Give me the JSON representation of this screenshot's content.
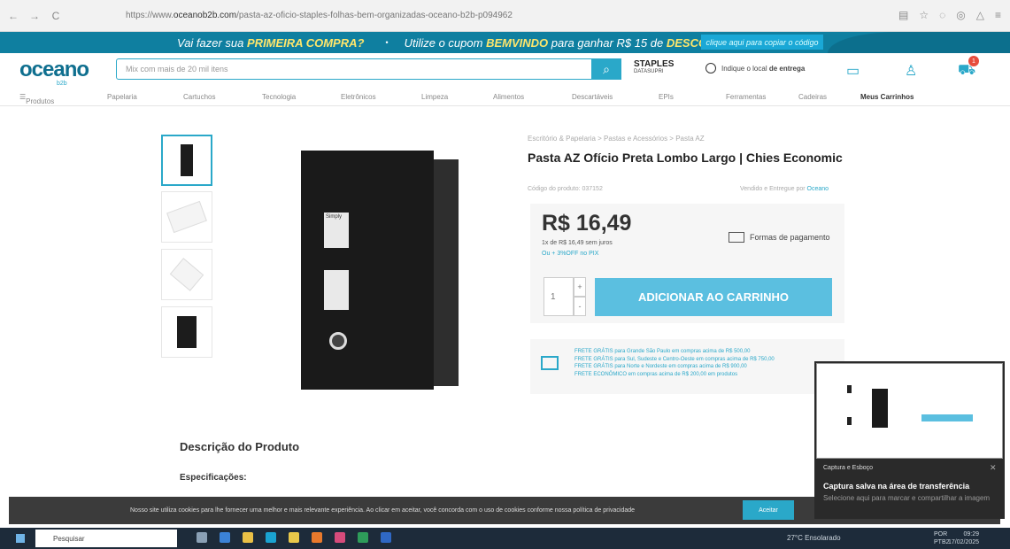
{
  "browser": {
    "url_prefix": "https://www.",
    "url_host": "oceanob2b.com",
    "url_path": "/pasta-az-oficio-staples-folhas-bem-organizadas-oceano-b2b-p094962"
  },
  "promo": {
    "part1": "Vai fazer sua ",
    "part1_bold": "PRIMEIRA COMPRA?",
    "part2": "Utilize o cupom ",
    "part2_bold": "BEMVINDO",
    "part3": " para ganhar R$ 15 de ",
    "part3_bold": "DESCONTO",
    "cta": "clique aqui para copiar o código"
  },
  "header": {
    "logo": "oceano",
    "logo_sub": "b2b",
    "search_placeholder": "Mix com mais de 20 mil itens",
    "staples": "STAPLES",
    "staples_sub": "DATASUPRI",
    "location_prefix": "Indique o local ",
    "location_bold": "de entrega",
    "cart_count": "1"
  },
  "categories": [
    "Produtos",
    "Papelaria",
    "Cartuchos",
    "Tecnologia",
    "Eletrônicos",
    "Limpeza",
    "Alimentos",
    "Descartáveis",
    "EPIs",
    "Ferramentas",
    "Cadeiras",
    "Meus Carrinhos"
  ],
  "product": {
    "breadcrumb": "Escritório & Papelaria > Pastas e Acessórios > Pasta AZ",
    "title": "Pasta AZ Ofício Preta Lombo Largo | Chies Economic",
    "code": "Código do produto: 037152",
    "sold_prefix": "Vendido e Entregue por ",
    "sold_by": "Oceano",
    "price": "R$ 16,49",
    "installments": "1x de R$ 16,49 sem juros",
    "pix": "Ou + 3%OFF no PIX",
    "payment_label": "Formas de pagamento",
    "qty": "1",
    "add_to_cart": "ADICIONAR AO CARRINHO",
    "label_brand": "Simply",
    "shipping": [
      "FRETE GRÁTIS para Grande São Paulo em compras acima de R$ 500,00",
      "FRETE GRÁTIS para Sul, Sudeste e Centro-Oeste em compras acima de R$ 750,00",
      "FRETE GRÁTIS para Norte e Nordeste em compras acima de R$ 900,00",
      "FRETE ECONÔMICO em compras acima de R$ 200,00 em produtos"
    ],
    "description_title": "Descrição do Produto",
    "specs_title": "Especificações:"
  },
  "cookie": {
    "text": "Nosso site utiliza cookies para lhe fornecer uma melhor e mais relevante experiência. Ao clicar em aceitar, você concorda com o uso de cookies conforme nossa política de privacidade",
    "accept": "Aceitar"
  },
  "toast": {
    "app": "Captura e Esboço",
    "title": "Captura salva na área de transferência",
    "body": "Selecione aqui para marcar e compartilhar a imagem"
  },
  "taskbar": {
    "search": "Pesquisar",
    "weather": "27°C  Ensolarado",
    "lang": "POR",
    "lang2": "PTB2",
    "time": "09:29",
    "date": "17/02/2025"
  }
}
